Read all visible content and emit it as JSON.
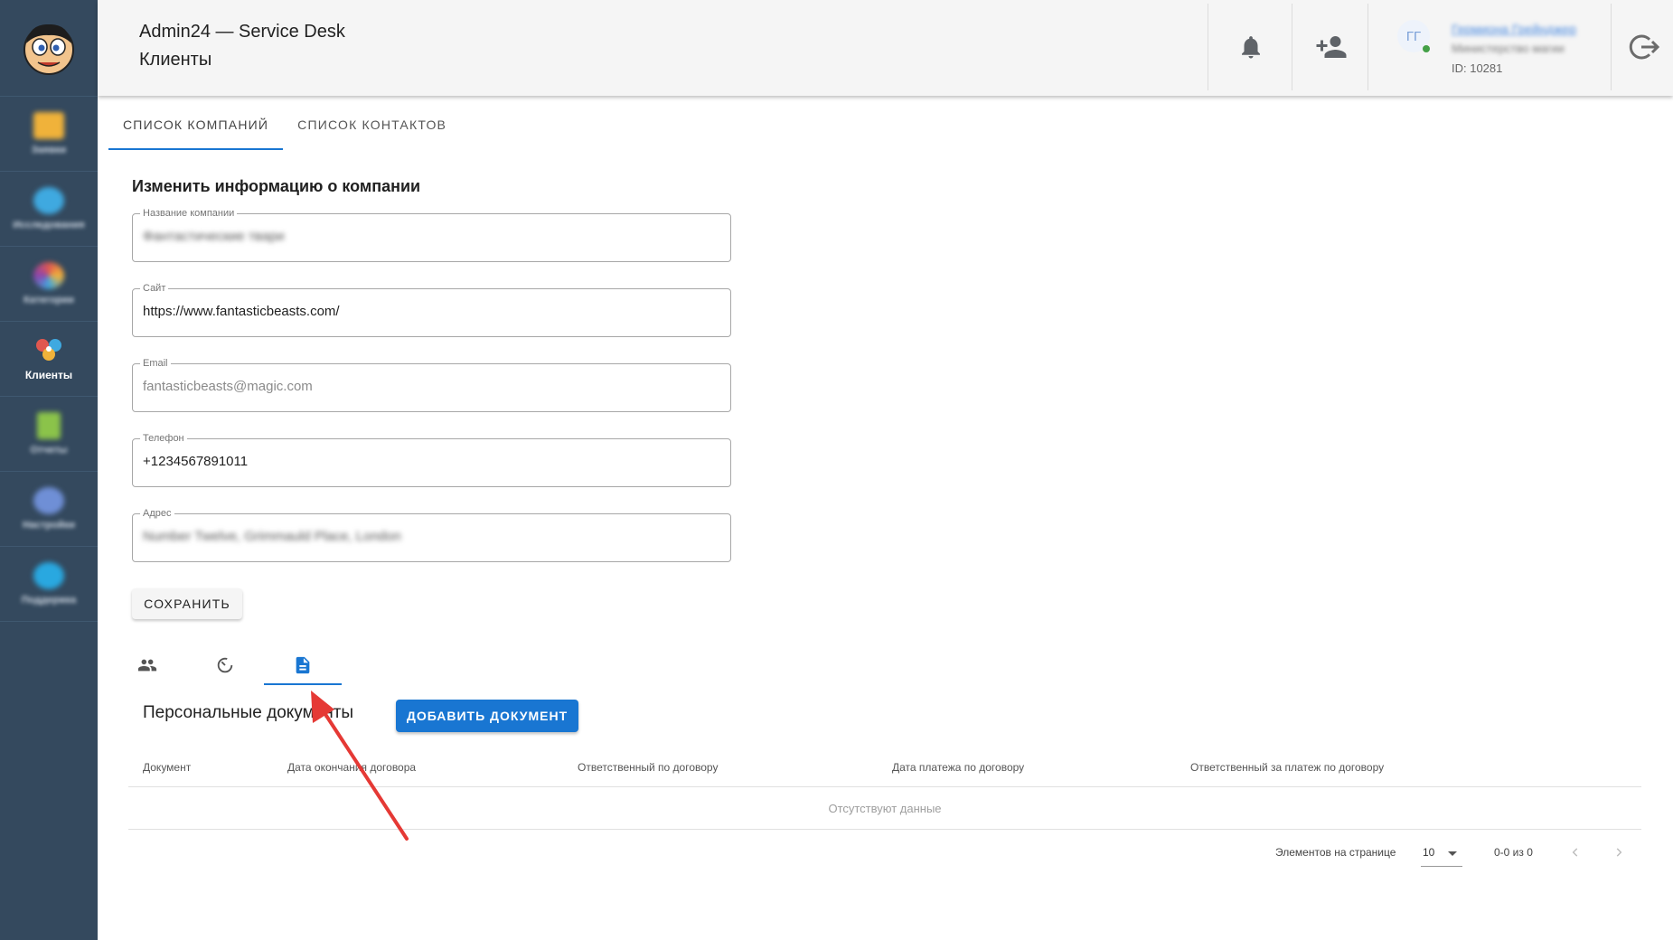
{
  "header": {
    "app_title": "Admin24 — Service Desk",
    "page_title": "Клиенты",
    "user": {
      "initials": "ГГ",
      "name": "Гермиона Грейнджер",
      "role": "Министерство магии",
      "id": "ID: 10281"
    }
  },
  "sidebar": {
    "items": [
      {
        "label": "Заявки",
        "icon": "folder-icon",
        "color": "#f0b23a"
      },
      {
        "label": "Исследования",
        "icon": "globe-icon",
        "color": "#3fa9e0"
      },
      {
        "label": "Категории",
        "icon": "palette-icon",
        "color": "#e0574f"
      },
      {
        "label": "Клиенты",
        "icon": "clients-icon",
        "color": "#e0574f"
      },
      {
        "label": "Отчеты",
        "icon": "report-icon",
        "color": "#8bc34a"
      },
      {
        "label": "Настройки",
        "icon": "gear-icon",
        "color": "#6f8fd6"
      },
      {
        "label": "Поддержка",
        "icon": "support-icon",
        "color": "#29a8e0"
      }
    ]
  },
  "tabs": [
    "СПИСОК КОМПАНИЙ",
    "СПИСОК КОНТАКТОВ"
  ],
  "form": {
    "title": "Изменить информацию о компании",
    "company": {
      "label": "Название компании",
      "value": "Фантастические твари"
    },
    "site": {
      "label": "Сайт",
      "value": "https://www.fantasticbeasts.com/"
    },
    "email": {
      "label": "Email",
      "value": "fantasticbeasts@magic.com"
    },
    "phone": {
      "label": "Телефон",
      "value": "+1234567891011"
    },
    "address": {
      "label": "Адрес",
      "value": "Number Twelve, Grimmauld Place, London"
    },
    "save_label": "СОХРАНИТЬ"
  },
  "documents": {
    "title": "Персональные документы",
    "add_label": "ДОБАВИТЬ ДОКУМЕНТ",
    "columns": [
      "Документ",
      "Дата окончания договора",
      "Ответственный по договору",
      "Дата платежа по договору",
      "Ответственный за платеж по договору"
    ],
    "empty": "Отсутствуют данные",
    "pagination": {
      "per_page_label": "Элементов на странице",
      "per_page": "10",
      "range": "0-0 из 0"
    }
  },
  "colors": {
    "sidebar": "#34495e",
    "accent": "#1976d2",
    "arrow": "#e53935"
  }
}
